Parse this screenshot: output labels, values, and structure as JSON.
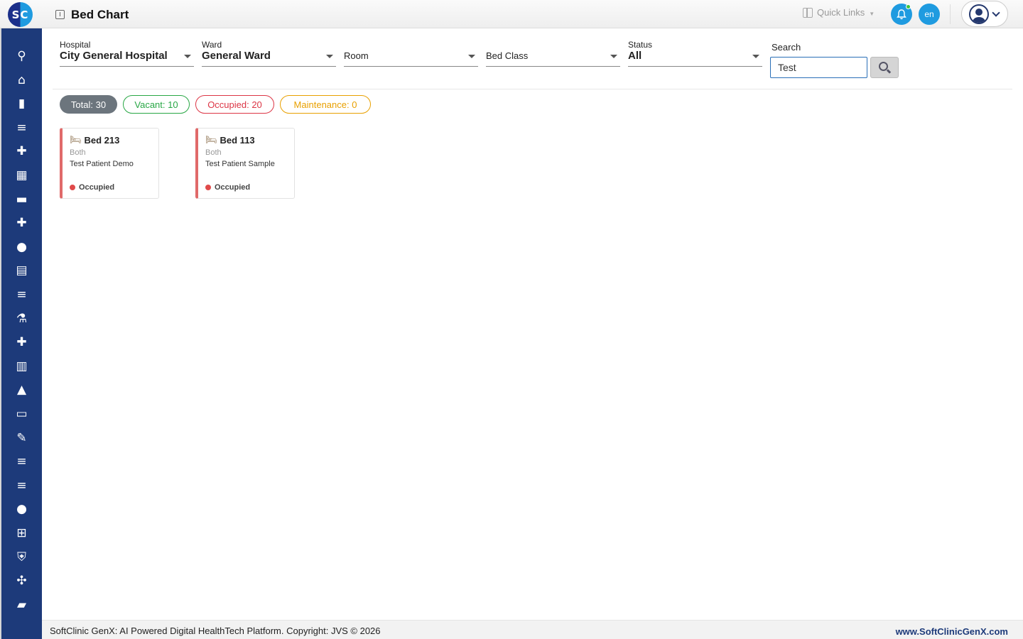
{
  "header": {
    "logo_text": "SC",
    "page_title": "Bed Chart",
    "quick_links": "Quick Links",
    "language": "en"
  },
  "sidebar": {
    "items": [
      {
        "icon": "search-icon",
        "glyph": "⚲"
      },
      {
        "icon": "home-icon",
        "glyph": "⌂"
      },
      {
        "icon": "bar-chart-icon",
        "glyph": "▮"
      },
      {
        "icon": "menu-icon",
        "glyph": "≡"
      },
      {
        "icon": "medical-bag-icon",
        "glyph": "✚"
      },
      {
        "icon": "calendar-icon",
        "glyph": "▦"
      },
      {
        "icon": "bed-icon",
        "glyph": "▬"
      },
      {
        "icon": "plus-box-icon",
        "glyph": "✚"
      },
      {
        "icon": "person-icon",
        "glyph": "●"
      },
      {
        "icon": "receipt-icon",
        "glyph": "▤"
      },
      {
        "icon": "menu-icon",
        "glyph": "≡"
      },
      {
        "icon": "lab-icon",
        "glyph": "⚗"
      },
      {
        "icon": "medicine-icon",
        "glyph": "✚"
      },
      {
        "icon": "book-icon",
        "glyph": "▥"
      },
      {
        "icon": "store-icon",
        "glyph": "▲"
      },
      {
        "icon": "devices-icon",
        "glyph": "▭"
      },
      {
        "icon": "wrench-icon",
        "glyph": "✎"
      },
      {
        "icon": "menu-icon",
        "glyph": "≡"
      },
      {
        "icon": "menu-icon",
        "glyph": "≡"
      },
      {
        "icon": "blood-drop-icon",
        "glyph": "●"
      },
      {
        "icon": "library-add-icon",
        "glyph": "⊞"
      },
      {
        "icon": "shield-icon",
        "glyph": "⛨"
      },
      {
        "icon": "network-icon",
        "glyph": "✣"
      },
      {
        "icon": "folder-icon",
        "glyph": "▰"
      }
    ]
  },
  "filters": {
    "hospital": {
      "label": "Hospital",
      "value": "City General Hospital"
    },
    "ward": {
      "label": "Ward",
      "value": "General Ward"
    },
    "room": {
      "placeholder": "Room"
    },
    "bed_class": {
      "placeholder": "Bed Class"
    },
    "status": {
      "label": "Status",
      "value": "All"
    },
    "search": {
      "label": "Search",
      "value": "Test"
    }
  },
  "summary": {
    "total": "Total: 30",
    "vacant": "Vacant: 10",
    "occupied": "Occupied: 20",
    "maintenance": "Maintenance: 0"
  },
  "beds": [
    {
      "name": "Bed 213",
      "type": "Both",
      "patient": "Test Patient Demo",
      "status": "Occupied"
    },
    {
      "name": "Bed 113",
      "type": "Both",
      "patient": "Test Patient Sample",
      "status": "Occupied"
    }
  ],
  "footer": {
    "copyright": "SoftClinic GenX: AI Powered Digital HealthTech Platform. Copyright: JVS © 2026",
    "website": "www.SoftClinicGenX.com"
  },
  "colors": {
    "sidebar": "#1d3a7a",
    "accent": "#1f9be0",
    "vacant": "#28a745",
    "occupied": "#dc3545",
    "maintenance": "#e9a000"
  }
}
